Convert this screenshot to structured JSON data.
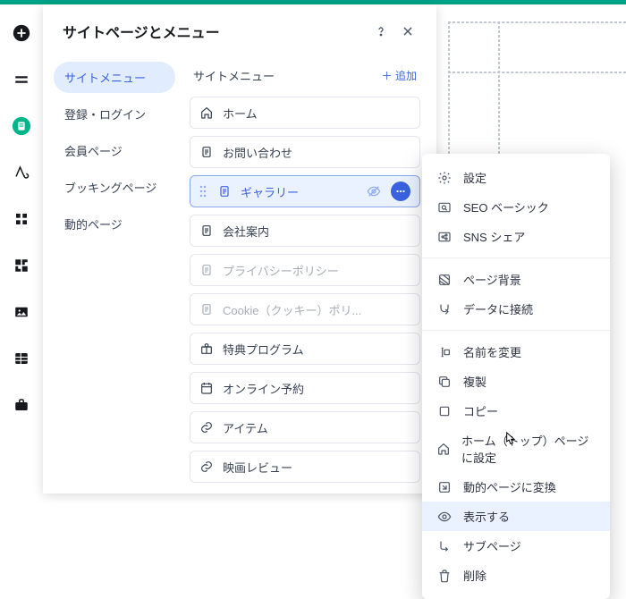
{
  "panel": {
    "title": "サイトページとメニュー"
  },
  "sidebar": {
    "items": [
      {
        "label": "サイトメニュー"
      },
      {
        "label": "登録・ログイン"
      },
      {
        "label": "会員ページ"
      },
      {
        "label": "ブッキングページ"
      },
      {
        "label": "動的ページ"
      }
    ]
  },
  "main": {
    "heading": "サイトメニュー",
    "add_label": "＋ 追加",
    "pages": [
      {
        "label": "ホーム",
        "icon": "home"
      },
      {
        "label": "お問い合わせ",
        "icon": "page"
      },
      {
        "label": "ギャラリー",
        "icon": "page",
        "selected": true
      },
      {
        "label": "会社案内",
        "icon": "page"
      },
      {
        "label": "プライバシーポリシー",
        "icon": "page",
        "muted": true
      },
      {
        "label": "Cookie（クッキー）ポリ...",
        "icon": "page",
        "muted": true
      },
      {
        "label": "特典プログラム",
        "icon": "gift"
      },
      {
        "label": "オンライン予約",
        "icon": "cal"
      },
      {
        "label": "アイテム",
        "icon": "link"
      },
      {
        "label": "映画レビュー",
        "icon": "link"
      }
    ]
  },
  "ctx": {
    "groups": [
      [
        {
          "label": "設定",
          "icon": "gear"
        },
        {
          "label": "SEO ベーシック",
          "icon": "seo"
        },
        {
          "label": "SNS シェア",
          "icon": "share"
        }
      ],
      [
        {
          "label": "ページ背景",
          "icon": "bg"
        },
        {
          "label": "データに接続",
          "icon": "data"
        }
      ],
      [
        {
          "label": "名前を変更",
          "icon": "rename"
        },
        {
          "label": "複製",
          "icon": "dup"
        },
        {
          "label": "コピー",
          "icon": "copy"
        },
        {
          "label": "ホーム（トップ）ページに設定",
          "icon": "home"
        },
        {
          "label": "動的ページに変換",
          "icon": "dyn"
        },
        {
          "label": "表示する",
          "icon": "eye",
          "hl": true
        },
        {
          "label": "サブページ",
          "icon": "sub"
        },
        {
          "label": "削除",
          "icon": "trash"
        }
      ]
    ]
  }
}
